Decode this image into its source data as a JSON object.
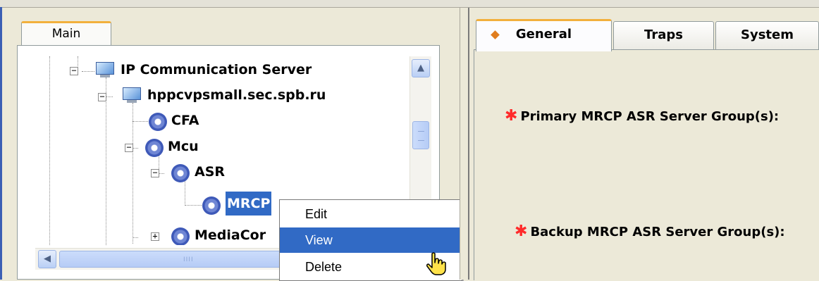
{
  "left_panel": {
    "tab_label": "Main",
    "tree": [
      {
        "label": "IP Communication Server",
        "icon": "server-monitor-icon",
        "expanded": true
      },
      {
        "label": "hppcvpsmall.sec.spb.ru",
        "icon": "server-monitor-icon",
        "expanded": true
      },
      {
        "label": "CFA",
        "icon": "gear-icon"
      },
      {
        "label": "Mcu",
        "icon": "gear-icon",
        "expanded": true
      },
      {
        "label": "ASR",
        "icon": "gear-icon",
        "expanded": true
      },
      {
        "label": "MRCP",
        "icon": "gear-icon",
        "selected": true
      },
      {
        "label": "MediaCor",
        "icon": "gear-icon",
        "expanded": false
      }
    ]
  },
  "context_menu": {
    "items": [
      {
        "label": "Edit"
      },
      {
        "label": "View",
        "highlighted": true
      },
      {
        "label": "Delete"
      }
    ]
  },
  "right_panel": {
    "tabs": [
      {
        "label": "General",
        "active": true
      },
      {
        "label": "Traps"
      },
      {
        "label": "System"
      }
    ],
    "fields": {
      "primary_label": "Primary MRCP ASR Server Group(s):",
      "backup_label": "Backup MRCP ASR Server Group(s):",
      "required_marker": "✱"
    }
  },
  "colors": {
    "selection": "#316ac5",
    "tab_accent": "#f2b03c",
    "required_star": "#ff2a2a"
  }
}
